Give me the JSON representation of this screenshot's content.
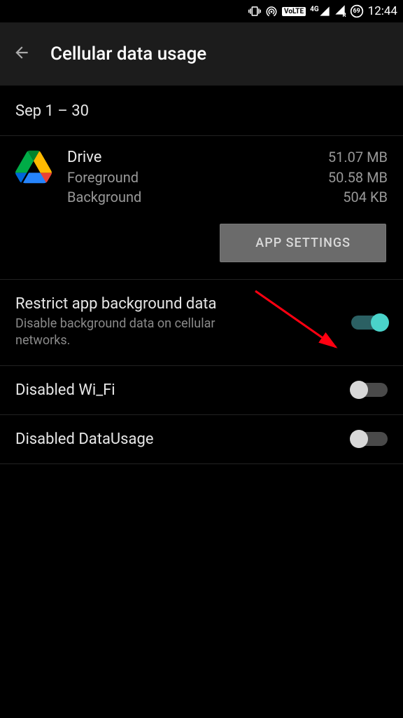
{
  "status": {
    "volte": "VoLTE",
    "network": "4G",
    "battery": "69",
    "time": "12:44"
  },
  "header": {
    "title": "Cellular data usage"
  },
  "date_range": "Sep 1 – 30",
  "app": {
    "name": "Drive",
    "total": "51.07 MB",
    "foreground_label": "Foreground",
    "foreground_value": "50.58 MB",
    "background_label": "Background",
    "background_value": "504 KB"
  },
  "buttons": {
    "app_settings": "APP SETTINGS"
  },
  "toggles": [
    {
      "title": "Restrict app background data",
      "desc": "Disable background data on cellular networks.",
      "on": true
    },
    {
      "title": "Disabled Wi_Fi",
      "desc": "",
      "on": false
    },
    {
      "title": "Disabled DataUsage",
      "desc": "",
      "on": false
    }
  ]
}
